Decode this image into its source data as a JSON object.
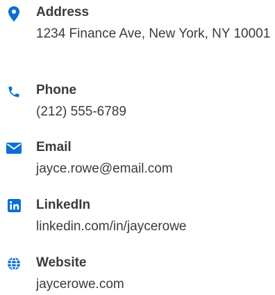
{
  "colors": {
    "icon": "#0a6fd1",
    "text": "#3b3b3b"
  },
  "items": [
    {
      "label": "Address",
      "value": "1234 Finance Ave, New York, NY 10001",
      "icon": "location-pin-icon"
    },
    {
      "label": "Phone",
      "value": "(212) 555-6789",
      "icon": "phone-icon"
    },
    {
      "label": "Email",
      "value": "jayce.rowe@email.com",
      "icon": "envelope-icon"
    },
    {
      "label": "LinkedIn",
      "value": "linkedin.com/in/jaycerowe",
      "icon": "linkedin-icon"
    },
    {
      "label": "Website",
      "value": "jaycerowe.com",
      "icon": "globe-icon"
    }
  ]
}
